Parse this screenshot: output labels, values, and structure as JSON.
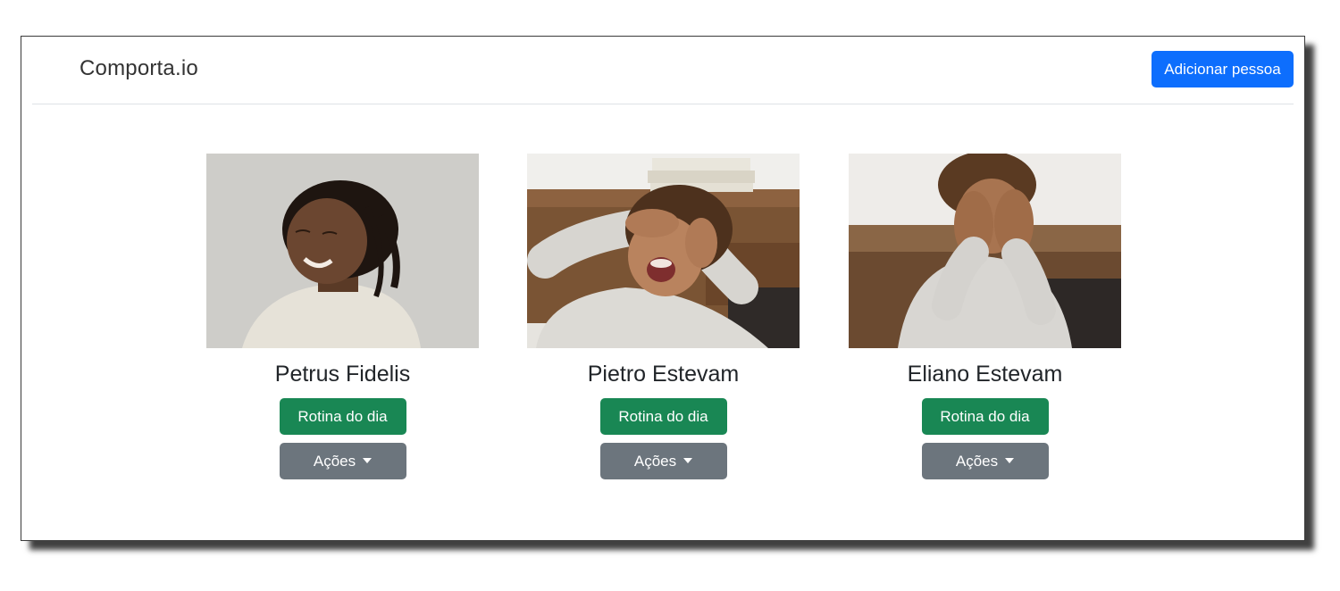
{
  "app": {
    "brand": "Comporta.io",
    "add_person_label": "Adicionar pessoa"
  },
  "people": [
    {
      "name": "Petrus Fidelis",
      "routine_label": "Rotina do dia",
      "actions_label": "Ações"
    },
    {
      "name": "Pietro Estevam",
      "routine_label": "Rotina do dia",
      "actions_label": "Ações"
    },
    {
      "name": "Eliano Estevam",
      "routine_label": "Rotina do dia",
      "actions_label": "Ações"
    }
  ],
  "colors": {
    "primary": "#0d6efd",
    "success": "#198754",
    "secondary": "#6c757d"
  }
}
